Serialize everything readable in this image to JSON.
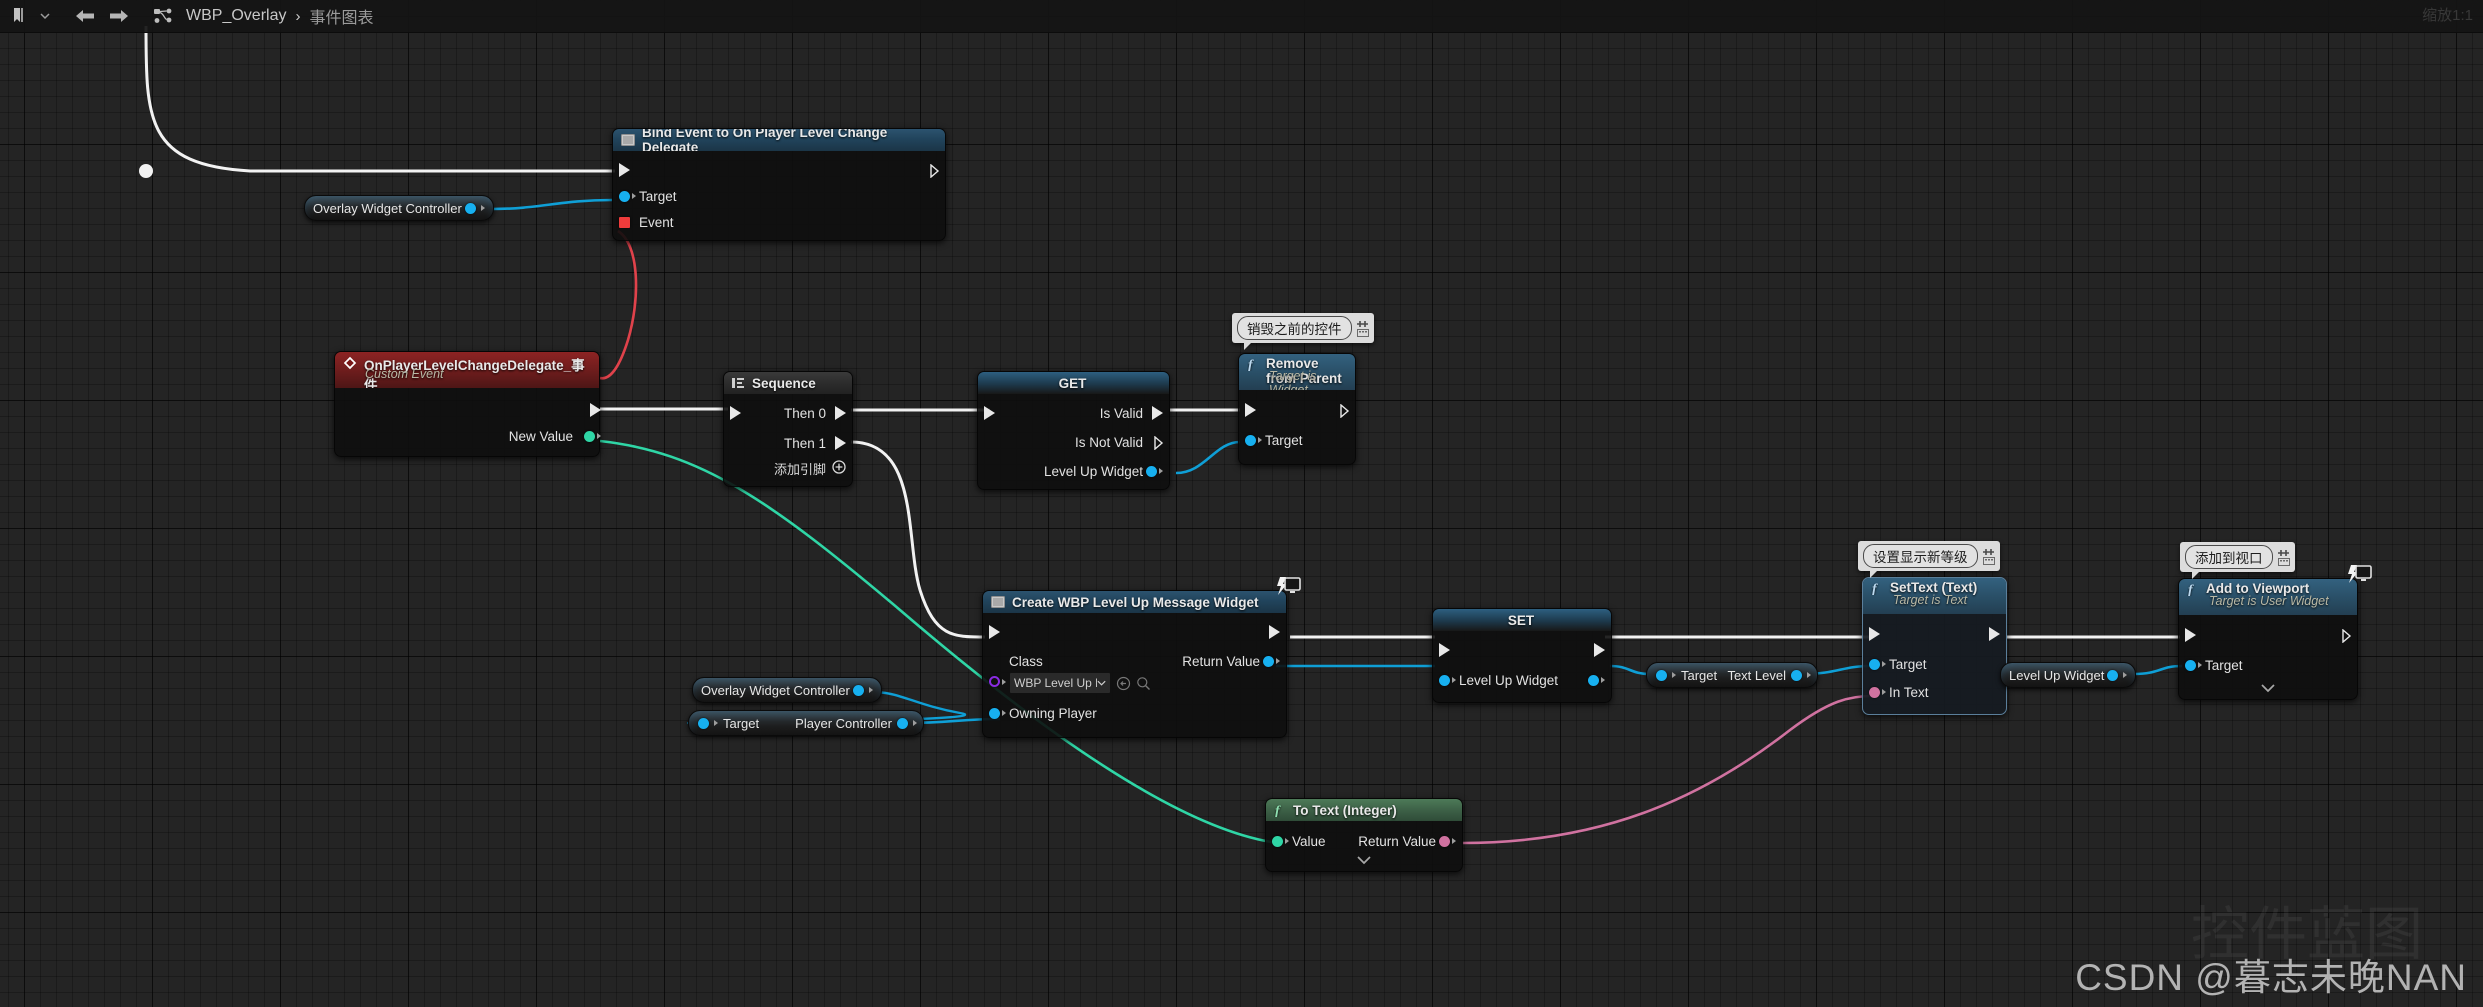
{
  "toolbar": {
    "bookmark_icon": "bookmark-icon",
    "dropdown_icon": "chevron-down-icon",
    "back_icon": "arrow-left-icon",
    "forward_icon": "arrow-right-icon",
    "graph_icon": "blueprint-graph-icon",
    "breadcrumb": {
      "root": "WBP_Overlay",
      "separator": "›",
      "current": "事件图表"
    },
    "zoom_label": "缩放1:1"
  },
  "nodes": {
    "bind_event": {
      "title": "Bind Event to On Player Level Change Delegate",
      "icon": "widget-node-icon",
      "pins": {
        "target": "Target",
        "event": "Event"
      }
    },
    "overlay_widget_controller_1": {
      "label": "Overlay Widget Controller"
    },
    "custom_event": {
      "title": "OnPlayerLevelChangeDelegate_事件",
      "subtitle": "Custom Event",
      "icon": "custom-event-icon",
      "pins": {
        "new_value": "New Value"
      }
    },
    "sequence": {
      "title": "Sequence",
      "icon": "sequence-icon",
      "pins": {
        "then_0": "Then 0",
        "then_1": "Then 1"
      },
      "add_pin": "添加引脚"
    },
    "get_valid": {
      "title": "GET",
      "pins": {
        "is_valid": "Is Valid",
        "is_not_valid": "Is Not Valid",
        "level_up_widget": "Level Up Widget"
      }
    },
    "remove_from_parent": {
      "title": "Remove from Parent",
      "subtitle": "Target is Widget",
      "icon": "function-f-icon",
      "comment": "销毁之前的控件",
      "pins": {
        "target": "Target"
      }
    },
    "create_widget": {
      "title": "Create WBP Level Up Message Widget",
      "icon": "widget-node-icon",
      "pins": {
        "class": "Class",
        "owning_player": "Owning Player",
        "return_value": "Return Value"
      },
      "class_value": "WBP Level Up M"
    },
    "overlay_widget_controller_2": {
      "label": "Overlay Widget Controller"
    },
    "get_player_controller": {
      "target_label": "Target",
      "value_label": "Player Controller"
    },
    "set_level_up_widget": {
      "title": "SET",
      "pins": {
        "level_up_widget": "Level Up Widget"
      }
    },
    "text_level_getter": {
      "target_label": "Target",
      "value_label": "Text Level"
    },
    "set_text": {
      "title": "SetText (Text)",
      "subtitle": "Target is Text",
      "icon": "function-f-icon",
      "comment": "设置显示新等级",
      "pins": {
        "target": "Target",
        "in_text": "In Text"
      }
    },
    "to_text_integer": {
      "title": "To Text (Integer)",
      "icon": "function-f-icon",
      "pins": {
        "value": "Value",
        "return_value": "Return Value"
      }
    },
    "level_up_widget_getter": {
      "label": "Level Up Widget"
    },
    "add_to_viewport": {
      "title": "Add to Viewport",
      "subtitle": "Target is User Widget",
      "icon": "function-f-icon",
      "comment": "添加到视口",
      "pins": {
        "target": "Target"
      }
    }
  },
  "watermark": {
    "text": "CSDN @暮志未晚NAN",
    "ghost": "控件蓝图"
  },
  "colors": {
    "exec_wire": "#f2f2f2",
    "object_wire": "#0f9fd6",
    "int_wire": "#2fd6a6",
    "text_wire": "#d072a0",
    "delegate_wire": "#e0424b",
    "object_pin": "#17b0f0",
    "int_pin": "#2fd6a6",
    "text_pin": "#d072a0",
    "class_pin": "#8a2be2",
    "delegate_pin": "#ee3b3b",
    "background": "#242424"
  }
}
